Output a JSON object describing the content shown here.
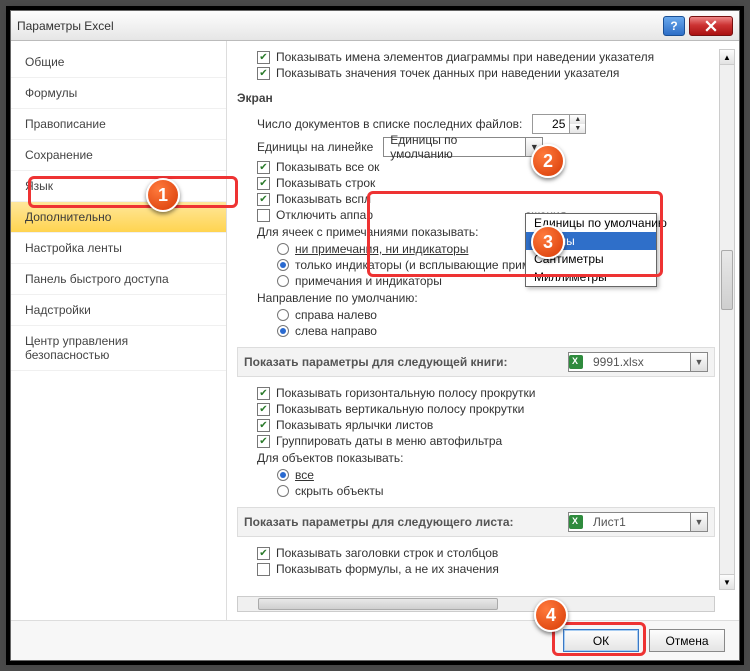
{
  "window": {
    "title": "Параметры Excel"
  },
  "sidebar": {
    "items": [
      "Общие",
      "Формулы",
      "Правописание",
      "Сохранение",
      "Язык",
      "Дополнительно",
      "Настройка ленты",
      "Панель быстрого доступа",
      "Надстройки",
      "Центр управления безопасностью"
    ],
    "active_index": 5
  },
  "top_checks": [
    "Показывать имена элементов диаграммы при наведении указателя",
    "Показывать значения точек данных при наведении указателя"
  ],
  "section_screen": "Экран",
  "recent_docs": {
    "label": "Число документов в списке последних файлов:",
    "value": "25"
  },
  "ruler": {
    "label": "Единицы на линейке",
    "selected": "Единицы по умолчанию",
    "options": [
      "Единицы по умолчанию",
      "Дюймы",
      "Сантиметры",
      "Миллиметры"
    ],
    "highlight_index": 1
  },
  "screen_checks": [
    {
      "label": "Показывать все ок",
      "checked": true
    },
    {
      "label": "Показывать строк",
      "checked": true
    },
    {
      "label": "Показывать вспл",
      "checked": true
    },
    {
      "label_full": "Отключить аппаратное ускорение обработки изображения",
      "label_vis_l": "Отключить аппар",
      "label_vis_r": "ажения",
      "checked": false
    }
  ],
  "cells_notes": {
    "label": "Для ячеек с примечаниями показывать:",
    "options": [
      "ни примечания, ни индикаторы",
      "только индикаторы (и всплывающие примечания)",
      "примечания и индикаторы"
    ],
    "selected_index": 1
  },
  "direction": {
    "label": "Направление по умолчанию:",
    "options": [
      "справа налево",
      "слева направо"
    ],
    "selected_index": 1
  },
  "book_band": {
    "label": "Показать параметры для следующей книги:",
    "value": "9991.xlsx"
  },
  "book_checks": [
    {
      "label": "Показывать горизонтальную полосу прокрутки",
      "checked": true
    },
    {
      "label": "Показывать вертикальную полосу прокрутки",
      "checked": true
    },
    {
      "label": "Показывать ярлычки листов",
      "checked": true
    },
    {
      "label": "Группировать даты в меню автофильтра",
      "checked": true
    }
  ],
  "objects": {
    "label": "Для объектов показывать:",
    "options": [
      "все",
      "скрыть объекты"
    ],
    "selected_index": 0
  },
  "sheet_band": {
    "label": "Показать параметры для следующего листа:",
    "value": "Лист1"
  },
  "sheet_checks": [
    {
      "label": "Показывать заголовки строк и столбцов",
      "checked": true
    },
    {
      "label": "Показывать формулы, а не их значения",
      "checked": false
    }
  ],
  "buttons": {
    "ok": "ОК",
    "cancel": "Отмена"
  },
  "callouts": {
    "c1": "1",
    "c2": "2",
    "c3": "3",
    "c4": "4"
  }
}
